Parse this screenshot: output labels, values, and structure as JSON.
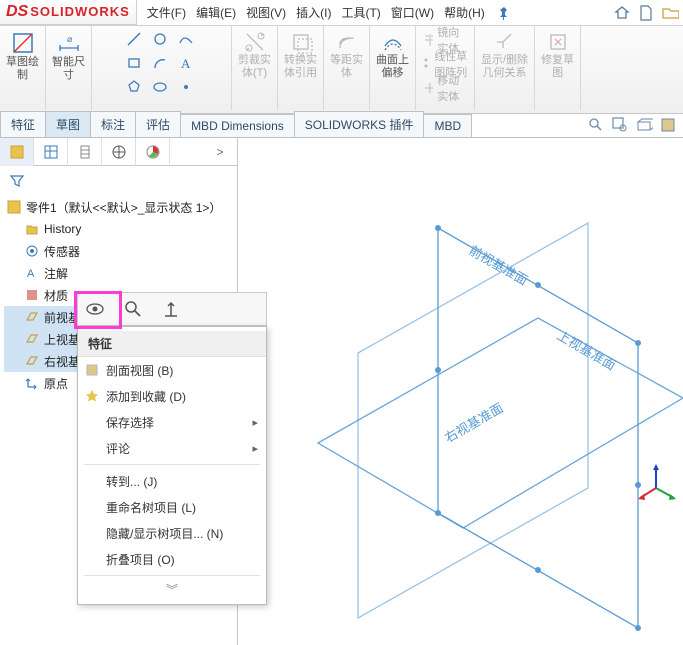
{
  "logo": {
    "ds": "DS",
    "sw": "SOLIDWORKS"
  },
  "menu": {
    "file": "文件(F)",
    "edit": "编辑(E)",
    "view": "视图(V)",
    "insert": "插入(I)",
    "tools": "工具(T)",
    "window": "窗口(W)",
    "help": "帮助(H)"
  },
  "ribbon": {
    "sketchDraw": "草图绘\n制",
    "smartDim": "智能尺\n寸",
    "trim": "剪裁实\n体(T)",
    "convert": "转换实\n体引用",
    "offset": "等距实\n体",
    "surfaceOffset": "曲面上\n偏移",
    "mirror": "镜向实体",
    "pattern": "线性草图阵列",
    "move": "移动实体",
    "showhide": "显示/删除\n几何关系",
    "repair": "修复草\n图"
  },
  "tabs": {
    "feature": "特征",
    "sketch": "草图",
    "annotate": "标注",
    "evaluate": "评估",
    "mbd": "MBD Dimensions",
    "swaddins": "SOLIDWORKS 插件",
    "mbd2": "MBD"
  },
  "tree": {
    "root": "零件1（默认<<默认>_显示状态 1>）",
    "history": "History",
    "sensor": "传感器",
    "annot": "注解",
    "material": "材质",
    "front": "前视基准面",
    "top": "上视基准面",
    "right": "右视基准面",
    "origin": "原点"
  },
  "viewport": {
    "front": "前视基准面",
    "top": "上视基准面",
    "right": "右视基准面"
  },
  "ctx": {
    "head": "特征",
    "section": "剖面视图  (B)",
    "addfav": "添加到收藏 (D)",
    "savesel": "保存选择",
    "comment": "评论",
    "goto": "转到... (J)",
    "rename": "重命名树项目 (L)",
    "hideshow": "隐藏/显示树项目... (N)",
    "collapse": "折叠项目 (O)",
    "more": "︾"
  }
}
